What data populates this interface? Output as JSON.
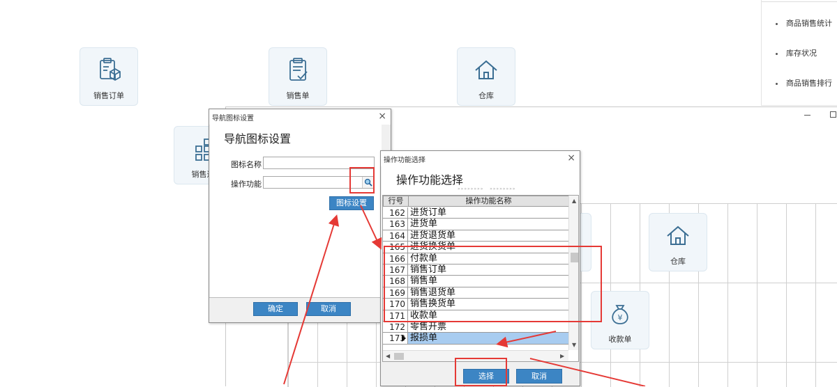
{
  "background_tiles": [
    {
      "label": "销售订单",
      "icon": "box-clipboard-icon"
    },
    {
      "label": "销售单",
      "icon": "clipboard-check-icon"
    },
    {
      "label": "仓库",
      "icon": "house-icon"
    },
    {
      "label": "销售退",
      "icon": "grid-squares-icon"
    },
    {
      "label": "仓库",
      "icon": "house-icon"
    },
    {
      "label": "收款单",
      "icon": "money-bag-icon"
    }
  ],
  "report_panel": {
    "items": [
      "商品销售统计",
      "库存状况",
      "商品销售排行"
    ]
  },
  "dialog_nav": {
    "title": "导航图标设置",
    "heading": "导航图标设置",
    "icon_name_label": "图标名称",
    "icon_name_value": "",
    "function_label": "操作功能",
    "function_value": "",
    "icon_settings_button": "图标设置",
    "ok_button": "确定",
    "cancel_button": "取消"
  },
  "dialog_func": {
    "title": "操作功能选择",
    "heading": "操作功能选择",
    "columns": [
      "行号",
      "操作功能名称"
    ],
    "rows": [
      {
        "num": "162",
        "name": "进货订单"
      },
      {
        "num": "163",
        "name": "进货单"
      },
      {
        "num": "164",
        "name": "进货退货单"
      },
      {
        "num": "165",
        "name": "进货换货单"
      },
      {
        "num": "166",
        "name": "付款单"
      },
      {
        "num": "167",
        "name": "销售订单"
      },
      {
        "num": "168",
        "name": "销售单"
      },
      {
        "num": "169",
        "name": "销售退货单"
      },
      {
        "num": "170",
        "name": "销售换货单"
      },
      {
        "num": "171",
        "name": "收款单"
      },
      {
        "num": "172",
        "name": "零售开票"
      },
      {
        "num": "173",
        "name": "报损单"
      }
    ],
    "selected_row": "173",
    "select_button": "选择",
    "cancel_button": "取消"
  },
  "colors": {
    "accent": "#3c85c4",
    "annotation": "#e53935",
    "selection": "#a8ccf0"
  }
}
